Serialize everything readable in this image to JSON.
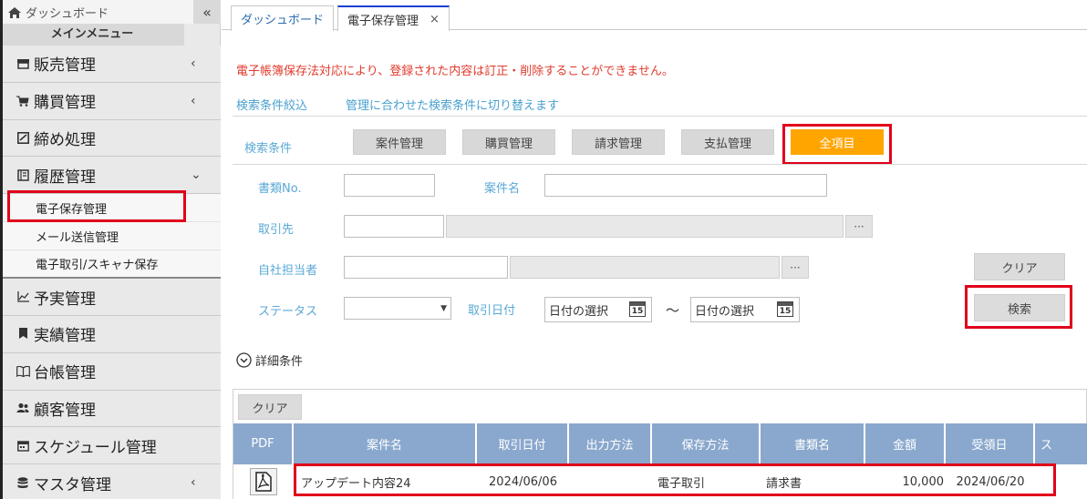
{
  "sidebar": {
    "home_label": "ダッシュボード",
    "collapse_glyph": "«",
    "main_menu_label": "メインメニュー",
    "items": [
      {
        "label": "販売管理",
        "icon": "store-icon"
      },
      {
        "label": "購買管理",
        "icon": "cart-icon"
      },
      {
        "label": "締め処理",
        "icon": "check-square-icon"
      },
      {
        "label": "履歴管理",
        "icon": "book-icon"
      },
      {
        "label": "予実管理",
        "icon": "chart-line-icon"
      },
      {
        "label": "実績管理",
        "icon": "bookmark-icon"
      },
      {
        "label": "台帳管理",
        "icon": "open-book-icon"
      },
      {
        "label": "顧客管理",
        "icon": "users-icon"
      },
      {
        "label": "スケジュール管理",
        "icon": "calendar-icon"
      },
      {
        "label": "マスタ管理",
        "icon": "database-icon"
      }
    ],
    "history_subitems": [
      "電子保存管理",
      "メール送信管理",
      "電子取引/スキャナ保存"
    ]
  },
  "tabs": [
    {
      "label": "ダッシュボード"
    },
    {
      "label": "電子保存管理",
      "close": "×"
    }
  ],
  "main": {
    "notice": "電子帳簿保存法対応により、登録された内容は訂正・削除することができません。",
    "filter_label": "検索条件絞込",
    "switch_link": "管理に合わせた検索条件に切り替えます",
    "search_condition_label": "検索条件",
    "category_buttons": [
      "案件管理",
      "購買管理",
      "請求管理",
      "支払管理",
      "全項目"
    ],
    "fields": {
      "doc_no_label": "書類No.",
      "project_name_label": "案件名",
      "partner_label": "取引先",
      "staff_label": "自社担当者",
      "status_label": "ステータス",
      "trade_date_label": "取引日付",
      "date_placeholder_from": "日付の選択",
      "date_placeholder_to": "日付の選択",
      "range_sep": "〜",
      "cal_day": "15",
      "dots": "···"
    },
    "clear_button": "クリア",
    "search_button": "検索",
    "detail_toggle": "詳細条件"
  },
  "table": {
    "clear_button": "クリア",
    "columns": [
      "PDF",
      "案件名",
      "取引日付",
      "出力方法",
      "保存方法",
      "書類名",
      "金額",
      "受領日",
      "ス"
    ],
    "rows": [
      {
        "project": "アップデート内容24",
        "trade_date": "2024/06/06",
        "output": "",
        "storage": "電子取引",
        "doc_name": "請求書",
        "amount": "10,000",
        "received": "2024/06/20"
      }
    ]
  }
}
